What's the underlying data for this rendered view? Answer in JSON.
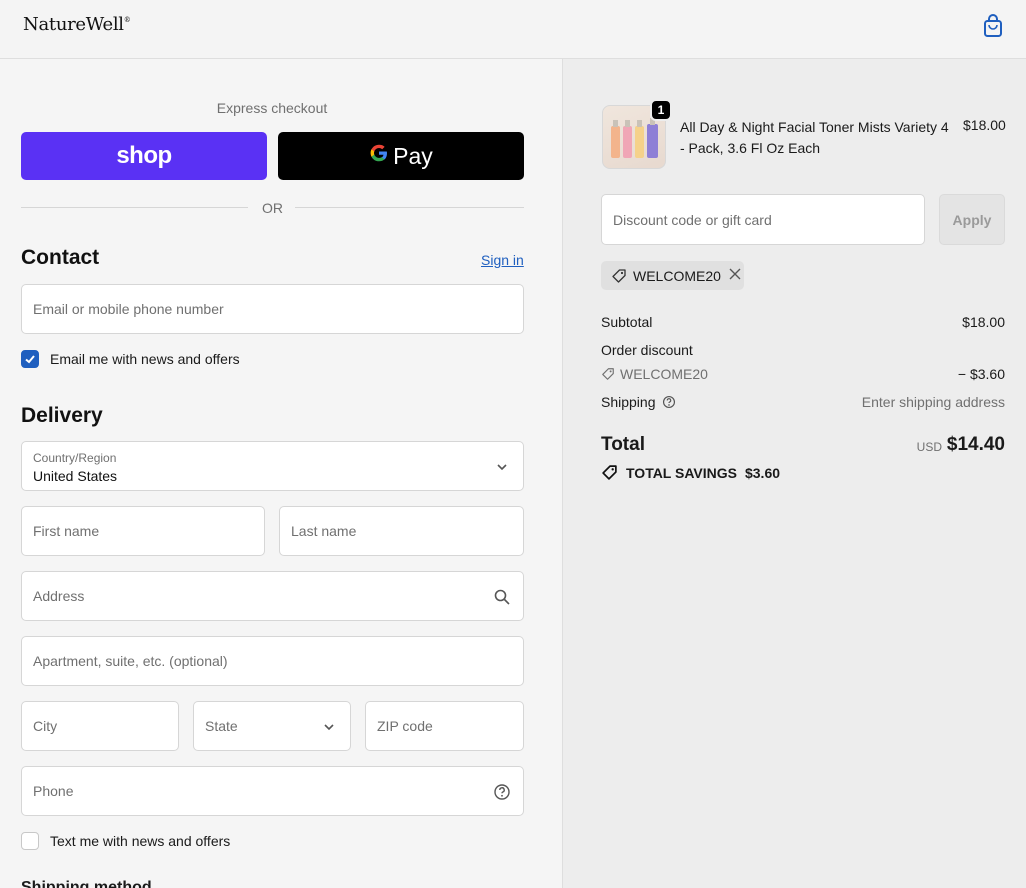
{
  "header": {
    "brand": "NatureWell",
    "brand_mark": "®",
    "cart_icon": "shopping-bag-icon"
  },
  "express": {
    "label": "Express checkout",
    "shop_label": "shop",
    "gpay_g": "G",
    "gpay_label": "Pay",
    "or_label": "OR"
  },
  "contact": {
    "title": "Contact",
    "sign_in": "Sign in",
    "email_placeholder": "Email or mobile phone number",
    "news_label": "Email me with news and offers",
    "news_checked": true
  },
  "delivery": {
    "title": "Delivery",
    "country_label": "Country/Region",
    "country_value": "United States",
    "first_name": "First name",
    "last_name": "Last name",
    "address": "Address",
    "apartment": "Apartment, suite, etc. (optional)",
    "city": "City",
    "state": "State",
    "zip": "ZIP code",
    "phone": "Phone",
    "sms_label": "Text me with news and offers",
    "sms_checked": false,
    "shipping_method": "Shipping method"
  },
  "summary": {
    "product": {
      "quantity": "1",
      "name": "All Day & Night Facial Toner Mists Variety 4 - Pack, 3.6 Fl Oz Each",
      "price": "$18.00"
    },
    "discount_placeholder": "Discount code or gift card",
    "apply_label": "Apply",
    "applied_code": "WELCOME20",
    "subtotal_label": "Subtotal",
    "subtotal_value": "$18.00",
    "order_discount_label": "Order discount",
    "order_discount_code": "WELCOME20",
    "order_discount_value": "− $3.60",
    "shipping_label": "Shipping",
    "shipping_value": "Enter shipping address",
    "total_label": "Total",
    "currency": "USD",
    "total_value": "$14.40",
    "savings_label": "TOTAL SAVINGS",
    "savings_value": "$3.60"
  },
  "colors": {
    "accent": "#1f5fbf",
    "shop_purple": "#5a31f4",
    "gpay_black": "#000000"
  }
}
